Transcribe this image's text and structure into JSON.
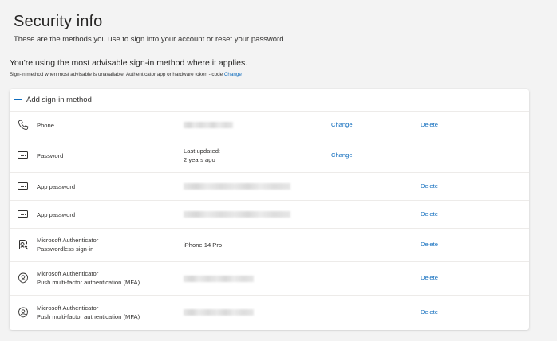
{
  "header": {
    "title": "Security info",
    "subtitle": "These are the methods you use to sign into your account or reset your password."
  },
  "advisory": {
    "headline": "You're using the most advisable sign-in method where it applies.",
    "fallback_text": "Sign-in method when most advisable is unavailable: Authenticator app or hardware token - code",
    "fallback_change_label": "Change"
  },
  "add_method_label": "Add sign-in method",
  "methods": [
    {
      "icon": "phone-icon",
      "name": "Phone",
      "name2": "",
      "detail": "",
      "detail2": "",
      "redacted": true,
      "change": "Change",
      "delete": "Delete"
    },
    {
      "icon": "password-icon",
      "name": "Password",
      "name2": "",
      "detail": "Last updated:",
      "detail2": "2 years ago",
      "redacted": false,
      "change": "Change",
      "delete": ""
    },
    {
      "icon": "app-password-icon",
      "name": "App password",
      "name2": "",
      "detail": "",
      "detail2": "",
      "redacted": true,
      "change": "",
      "delete": "Delete"
    },
    {
      "icon": "app-password-icon",
      "name": "App password",
      "name2": "",
      "detail": "",
      "detail2": "",
      "redacted": true,
      "change": "",
      "delete": "Delete"
    },
    {
      "icon": "authenticator-passwordless-icon",
      "name": "Microsoft Authenticator",
      "name2": "Passwordless sign-in",
      "detail": "iPhone 14 Pro",
      "detail2": "",
      "redacted": false,
      "change": "",
      "delete": "Delete"
    },
    {
      "icon": "authenticator-icon",
      "name": "Microsoft Authenticator",
      "name2": "Push multi-factor authentication (MFA)",
      "detail": "",
      "detail2": "",
      "redacted": true,
      "change": "",
      "delete": "Delete"
    },
    {
      "icon": "authenticator-icon",
      "name": "Microsoft Authenticator",
      "name2": "Push multi-factor authentication (MFA)",
      "detail": "",
      "detail2": "",
      "redacted": true,
      "change": "",
      "delete": "Delete"
    }
  ],
  "colors": {
    "accent": "#0f6cbd",
    "background": "#f3f3f3",
    "card": "#ffffff"
  }
}
